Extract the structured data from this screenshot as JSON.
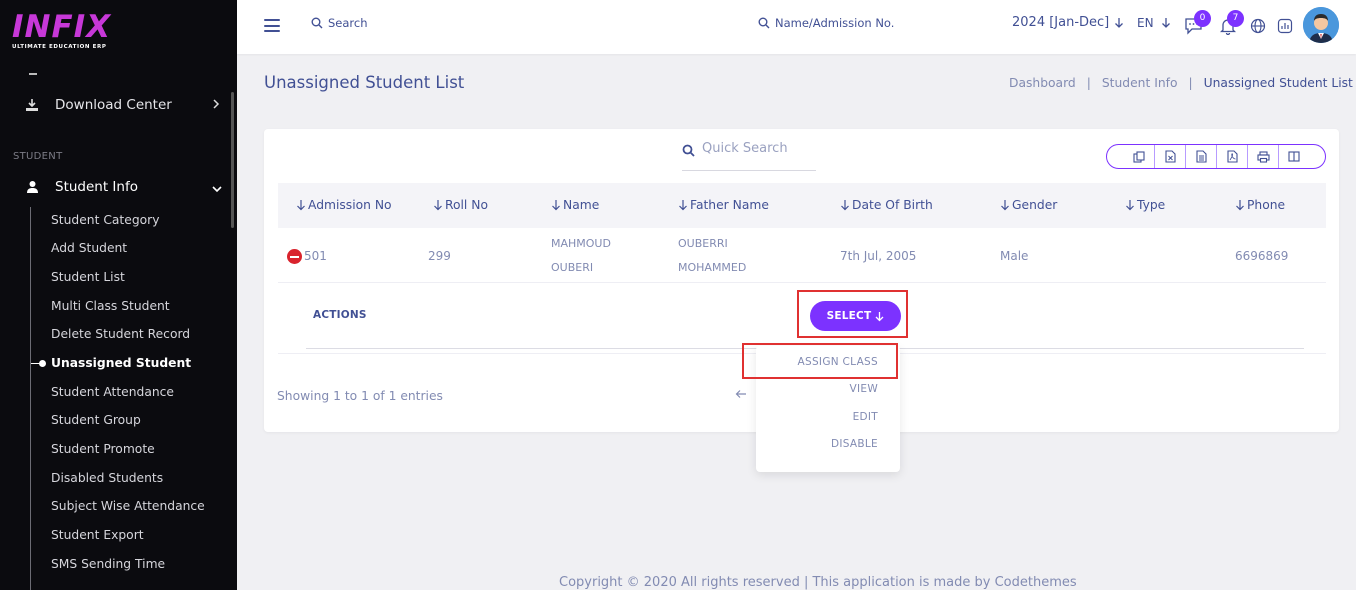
{
  "brand": {
    "name": "INFIX",
    "tagline": "ULTIMATE EDUCATION ERP"
  },
  "sidebar": {
    "download_center": "Download Center",
    "section_label": "STUDENT",
    "student_info": "Student Info",
    "sub_items": [
      "Student Category",
      "Add Student",
      "Student List",
      "Multi Class Student",
      "Delete Student Record",
      "Unassigned Student",
      "Student Attendance",
      "Student Group",
      "Student Promote",
      "Disabled Students",
      "Subject Wise Attendance",
      "Student Export",
      "SMS Sending Time"
    ],
    "active_item": "Unassigned Student"
  },
  "topbar": {
    "search_label": "Search",
    "search2_label": "Name/Admission No.",
    "session": "2024 [Jan-Dec]",
    "language": "EN",
    "messages_count": "0",
    "notifications_count": "7"
  },
  "page": {
    "title": "Unassigned Student List",
    "breadcrumb": [
      "Dashboard",
      "Student Info",
      "Unassigned Student List"
    ]
  },
  "table": {
    "quick_search_placeholder": "Quick Search",
    "export_icons": [
      "copy-icon",
      "excel-icon",
      "csv-icon",
      "pdf-icon",
      "print-icon",
      "columns-icon"
    ],
    "columns": [
      "Admission No",
      "Roll No",
      "Name",
      "Father Name",
      "Date Of Birth",
      "Gender",
      "Type",
      "Phone"
    ],
    "rows": [
      {
        "admission_no": "501",
        "roll_no": "299",
        "name_line1": "MAHMOUD",
        "name_line2": "OUBERI",
        "father_line1": "OUBERRI",
        "father_line2": "MOHAMMED",
        "dob": "7th Jul, 2005",
        "gender": "Male",
        "type": "",
        "phone": "6696869"
      }
    ],
    "actions_label": "ACTIONS",
    "select_label": "SELECT",
    "dropdown": [
      "ASSIGN CLASS",
      "VIEW",
      "EDIT",
      "DISABLE"
    ],
    "showing": "Showing 1 to 1 of 1 entries"
  },
  "footer": "Copyright © 2020 All rights reserved | This application is made by Codethemes",
  "colors": {
    "accent": "#7c32ff",
    "primary_text": "#415094",
    "muted_text": "#828bb2",
    "highlight": "#e03131"
  }
}
